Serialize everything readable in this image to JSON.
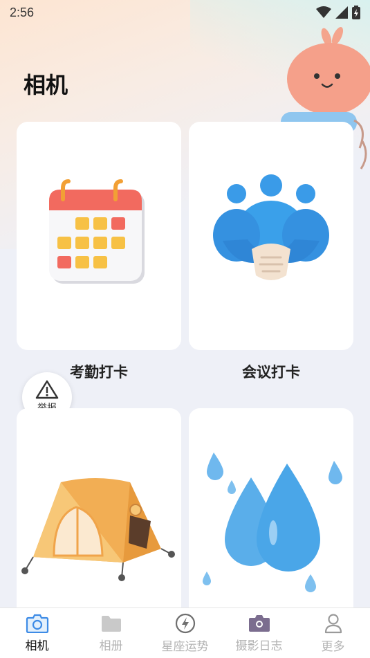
{
  "status": {
    "time": "2:56"
  },
  "page": {
    "title": "相机"
  },
  "report": {
    "label": "举报"
  },
  "cards": [
    {
      "label": "考勤打卡",
      "icon": "calendar-icon"
    },
    {
      "label": "会议打卡",
      "icon": "handshake-icon"
    },
    {
      "label": "",
      "icon": "tent-icon"
    },
    {
      "label": "",
      "icon": "water-drops-icon"
    }
  ],
  "tabs": [
    {
      "label": "相机",
      "icon": "camera-icon",
      "active": true
    },
    {
      "label": "相册",
      "icon": "folder-icon",
      "active": false
    },
    {
      "label": "星座运势",
      "icon": "lightning-icon",
      "active": false
    },
    {
      "label": "摄影日志",
      "icon": "camera-diary-icon",
      "active": false
    },
    {
      "label": "更多",
      "icon": "user-icon",
      "active": false
    }
  ],
  "colors": {
    "accent": "#3d8be6",
    "inactive": "#b3b3b3",
    "background": "#eef0f7"
  }
}
